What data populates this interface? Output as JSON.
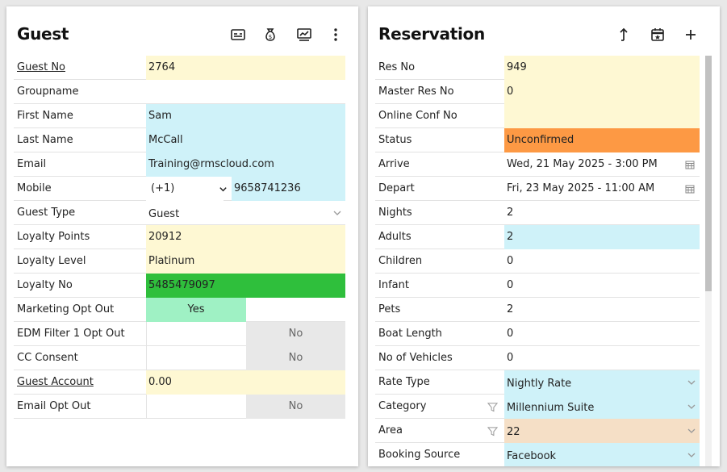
{
  "guest": {
    "title": "Guest",
    "icons": [
      "card-icon",
      "money-bag-icon",
      "chart-icon",
      "more-vertical-icon"
    ],
    "fields": {
      "guest_no": {
        "label": "Guest No",
        "value": "2764"
      },
      "groupname": {
        "label": "Groupname",
        "value": ""
      },
      "first_name": {
        "label": "First Name",
        "value": "Sam"
      },
      "last_name": {
        "label": "Last Name",
        "value": "McCall"
      },
      "email": {
        "label": "Email",
        "value": "Training@rmscloud.com"
      },
      "mobile": {
        "label": "Mobile",
        "code": "(+1)",
        "value": "9658741236"
      },
      "guest_type": {
        "label": "Guest Type",
        "value": "Guest"
      },
      "loyalty_points": {
        "label": "Loyalty Points",
        "value": "20912"
      },
      "loyalty_level": {
        "label": "Loyalty Level",
        "value": "Platinum"
      },
      "loyalty_no": {
        "label": "Loyalty No",
        "value": "5485479097"
      },
      "marketing_opt_out": {
        "label": "Marketing Opt Out",
        "value": "Yes"
      },
      "edm_filter": {
        "label": "EDM Filter 1 Opt Out",
        "value": "No"
      },
      "cc_consent": {
        "label": "CC Consent",
        "value": "No"
      },
      "guest_account": {
        "label": "Guest Account",
        "value": "0.00"
      },
      "email_opt_out": {
        "label": "Email Opt Out",
        "value": "No"
      }
    }
  },
  "reservation": {
    "title": "Reservation",
    "icons": [
      "upload-icon",
      "calendar-star-icon",
      "plus-icon"
    ],
    "fields": {
      "res_no": {
        "label": "Res No",
        "value": "949"
      },
      "master_res_no": {
        "label": "Master Res No",
        "value": "0"
      },
      "online_conf_no": {
        "label": "Online Conf No",
        "value": ""
      },
      "status": {
        "label": "Status",
        "value": "Unconfirmed"
      },
      "arrive": {
        "label": "Arrive",
        "value": "Wed, 21 May 2025 - 3:00 PM"
      },
      "depart": {
        "label": "Depart",
        "value": "Fri, 23 May 2025 - 11:00 AM"
      },
      "nights": {
        "label": "Nights",
        "value": "2"
      },
      "adults": {
        "label": "Adults",
        "value": "2"
      },
      "children": {
        "label": "Children",
        "value": "0"
      },
      "infant": {
        "label": "Infant",
        "value": "0"
      },
      "pets": {
        "label": "Pets",
        "value": "2"
      },
      "boat_length": {
        "label": "Boat Length",
        "value": "0"
      },
      "no_of_vehicles": {
        "label": "No of Vehicles",
        "value": "0"
      },
      "rate_type": {
        "label": "Rate Type",
        "value": "Nightly Rate"
      },
      "category": {
        "label": "Category",
        "value": "Millennium Suite"
      },
      "area": {
        "label": "Area",
        "value": "22"
      },
      "booking_source": {
        "label": "Booking Source",
        "value": "Facebook"
      }
    }
  },
  "colors": {
    "yellow_field": "#fef8d3",
    "blue_field": "#cff2f9",
    "green_field": "#2fbf3c",
    "orange_status": "#fd9944",
    "peach_field": "#f5dfc6",
    "yes_toggle": "#9ff1c4",
    "no_toggle": "#e8e8e8"
  }
}
